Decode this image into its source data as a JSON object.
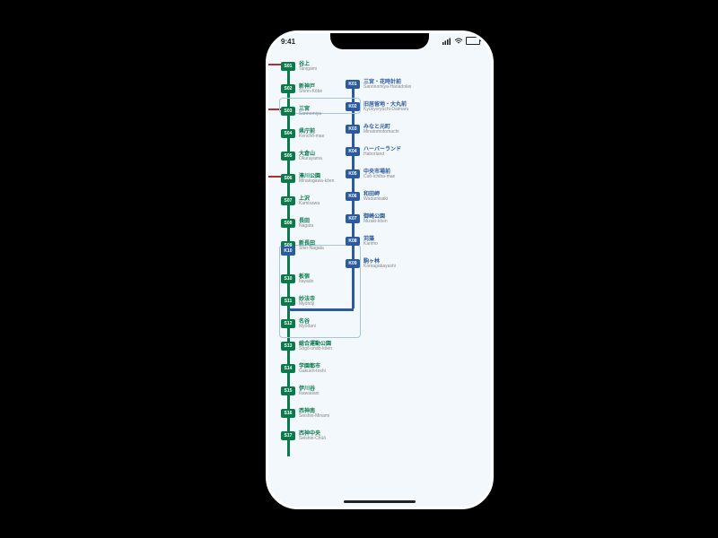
{
  "statusbar": {
    "time": "9:41"
  },
  "lines": {
    "green": {
      "color": "#0a7a4b"
    },
    "blue": {
      "color": "#2c5aa0"
    },
    "red": {
      "color": "#b03030"
    }
  },
  "green_stations": [
    {
      "code": "S01",
      "jp": "谷上",
      "en": "Tanigami",
      "red": true
    },
    {
      "code": "S02",
      "jp": "新神戸",
      "en": "Shinn-Kōbe"
    },
    {
      "code": "S03",
      "jp": "三宮",
      "en": "Sannomiya",
      "red": true
    },
    {
      "code": "S04",
      "jp": "県庁前",
      "en": "Kenchō-mae"
    },
    {
      "code": "S05",
      "jp": "大倉山",
      "en": "Okurayama"
    },
    {
      "code": "S06",
      "jp": "湊川公園",
      "en": "Minatogawa-kōen",
      "red": true
    },
    {
      "code": "S07",
      "jp": "上沢",
      "en": "Kamisawa"
    },
    {
      "code": "S08",
      "jp": "長田",
      "en": "Nagata"
    },
    {
      "code": "S09/K10",
      "jp": "新長田",
      "en": "Shin-Nagata",
      "transfer": true
    },
    {
      "code": "S10",
      "jp": "板宿",
      "en": "Itayado"
    },
    {
      "code": "S11",
      "jp": "妙法寺",
      "en": "Myōhōji"
    },
    {
      "code": "S12",
      "jp": "名谷",
      "en": "Myōdani"
    },
    {
      "code": "S13",
      "jp": "総合運動公園",
      "en": "Sōgō-undō-kōen"
    },
    {
      "code": "S14",
      "jp": "学園都市",
      "en": "Gakuen-toshi"
    },
    {
      "code": "S15",
      "jp": "伊川谷",
      "en": "Ikawadani"
    },
    {
      "code": "S16",
      "jp": "西神南",
      "en": "Seishin-Minami"
    },
    {
      "code": "S17",
      "jp": "西神中央",
      "en": "Seishin-Chūō"
    }
  ],
  "blue_stations": [
    {
      "code": "K01",
      "jp": "三宮・花時計前",
      "en": "Sannnomiya-Hanadokei"
    },
    {
      "code": "K02",
      "jp": "旧居留地・大丸前",
      "en": "Kyūkyoryūchi-Daimaru"
    },
    {
      "code": "K03",
      "jp": "みなと元町",
      "en": "Minatomotomachi"
    },
    {
      "code": "K04",
      "jp": "ハーバーランド",
      "en": "Haborland"
    },
    {
      "code": "K05",
      "jp": "中央市場前",
      "en": "Cuō-ichiba-mae"
    },
    {
      "code": "K06",
      "jp": "和田岬",
      "en": "Wadamisaki"
    },
    {
      "code": "K07",
      "jp": "御崎公園",
      "en": "Mizaki-kōen"
    },
    {
      "code": "K08",
      "jp": "苅藻",
      "en": "Karimo"
    },
    {
      "code": "K09",
      "jp": "駒ヶ林",
      "en": "Komagabayashi"
    }
  ]
}
